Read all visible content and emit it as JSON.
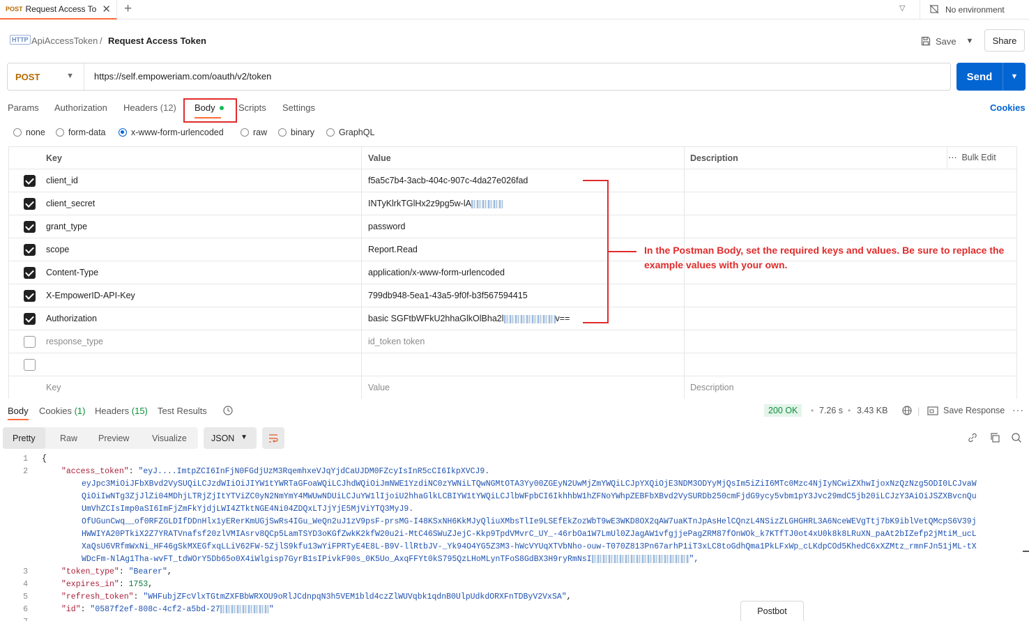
{
  "tab": {
    "method": "POST",
    "title": "Request Access To"
  },
  "environment": "No environment",
  "breadcrumb": {
    "collection": "ApiAccessToken",
    "separator": "/",
    "request": "Request Access Token",
    "icon": "http-icon"
  },
  "toolbar": {
    "save": "Save",
    "share": "Share"
  },
  "request": {
    "method": "POST",
    "url": "https://self.empoweriam.com/oauth/v2/token",
    "send": "Send"
  },
  "request_tabs": {
    "params": "Params",
    "authorization": "Authorization",
    "headers": "Headers",
    "headers_count": "(12)",
    "body": "Body",
    "scripts": "Scripts",
    "settings": "Settings",
    "cookies": "Cookies"
  },
  "body_types": [
    "none",
    "form-data",
    "x-www-form-urlencoded",
    "raw",
    "binary",
    "GraphQL"
  ],
  "body_type_selected": "x-www-form-urlencoded",
  "table": {
    "headers": {
      "key": "Key",
      "value": "Value",
      "description": "Description",
      "bulk_edit": "Bulk Edit"
    },
    "rows": [
      {
        "checked": true,
        "key": "client_id",
        "value": "f5a5c7b4-3acb-404c-907c-4da27e026fad"
      },
      {
        "checked": true,
        "key": "client_secret",
        "value": "INTyKlrkTGlHx2z9pg5w-lA"
      },
      {
        "checked": true,
        "key": "grant_type",
        "value": "password"
      },
      {
        "checked": true,
        "key": "scope",
        "value": "Report.Read"
      },
      {
        "checked": true,
        "key": "Content-Type",
        "value": "application/x-www-form-urlencoded"
      },
      {
        "checked": true,
        "key": "X-EmpowerID-API-Key",
        "value": "799db948-5ea1-43a5-9f0f-b3f567594415"
      },
      {
        "checked": true,
        "key": "Authorization",
        "value": "basic SGFtbWFkU2hhaGlkOlBha2l",
        "value_suffix": "v=="
      },
      {
        "checked": false,
        "key": "response_type",
        "value": "id_token token"
      }
    ],
    "placeholder": {
      "key": "Key",
      "value": "Value",
      "description": "Description"
    }
  },
  "annotation": "In the Postman Body, set the required keys and values. Be sure to replace the example values with your own.",
  "response": {
    "tabs": {
      "body": "Body",
      "cookies": "Cookies",
      "cookies_count": "(1)",
      "headers": "Headers",
      "headers_count": "(15)",
      "test_results": "Test Results"
    },
    "status": "200 OK",
    "time": "7.26 s",
    "size": "3.43 KB",
    "save_response": "Save Response",
    "views": [
      "Pretty",
      "Raw",
      "Preview",
      "Visualize"
    ],
    "format": "JSON"
  },
  "code": {
    "line_numbers": [
      "1",
      "2",
      "3",
      "4",
      "5",
      "6",
      "7"
    ],
    "open_brace": "{",
    "access_token_key": "\"access_token\"",
    "access_token_first": "\"eyJ....ImtpZCI6InFjN0FGdjUzM3RqemhxeVJqYjdCaUJDM0FZcyIsInR5cCI6IkpXVCJ9.",
    "access_token_lines": [
      "eyJpc3MiOiJFbXBvd2VySUQiLCJzdWIiOiJIYW1tYWRTaGFoaWQiLCJhdWQiOiJmNWE1YzdiNC0zYWNiLTQwNGMtOTA3Yy00ZGEyN2UwMjZmYWQiLCJpYXQiOjE3NDM3ODYyMjQsIm5iZiI6MTc0Mzc4NjIyNCwiZXhwIjoxNzQzNzg5ODI0LCJvaW",
      "QiOiIwNTg3ZjJlZi04MDhjLTRjZjItYTViZC0yN2NmYmY4MWUwNDUiLCJuYW1lIjoiU2hhaGlkLCBIYW1tYWQiLCJlbWFpbCI6IkhhbW1hZFNoYWhpZEBFbXBvd2VySURDb250cmFjdG9ycy5vbm1pY3Jvc29mdC5jb20iLCJzY3AiOiJSZXBvcnQu",
      "UmVhZCIsImp0aSI6ImFjZmFkYjdjLWI4ZTktNGE4Ni04ZDQxLTJjYjE5MjViYTQ3MyJ9.",
      "OfUGunCwq__of0RFZGLDIfDDnHlx1yERerKmUGjSwRs4IGu_WeQn2uJ1zV9psF-prsMG-I48KSxNH6KkMJyQliuXMbsTlIe9LSEfEkZozWbT9wE3WKD8OX2qAW7uaKTnJpAsHelCQnzL4NSizZLGHGHRL3A6NceWEVgTtj7bK9iblVetQMcpS6V39j",
      "HWWIYA20PTkiX2Z7YRATVnafsf20zlVMIAsrv8QCp5LamTSYD3oKGfZwkK2kfW20u2i-MtC46SWuZJejC-Kkp9TpdVMvrC_UY_-46rbOa1W7LmUl0ZJagAW1vfgjjePagZRM87fOnWOk_k7KTfTJ0ot4xU0k8k8LRuXN_paAt2bIZefp2jMtiM_ucL",
      "XaQsU6VRfmWxNi_HF46gSkMXEGfxqLLiV62FW-5ZjlS9kfu13wYiFPRTyE4E8L-B9V-llRtbJV-_Yk94O4YG5Z3M3-hWcVYUqXTVbNho-ouw-T070Z813Pn67arhP1iT3xLC8toGdhQma1PkLFxWp_cLKdpCOd5KhedC6xXZMtz_rmnFJn51jML-tX",
      "WDcFm-NlAg1Tha-wvFT_tdWOrY5Db65o0X4iWlgisp7GyrB1sIPivkF90s_0K5Uo_AxqFFYt0kS795QzLHoMLynTFoS8GdBX3H9ryRmNsI"
    ],
    "access_token_end": "\",",
    "token_type_key": "\"token_type\"",
    "token_type_val": "\"Bearer\"",
    "expires_in_key": "\"expires_in\"",
    "expires_in_val": "1753",
    "refresh_token_key": "\"refresh_token\"",
    "refresh_token_val": "\"WHFubjZFcVlxTGtmZXFBbWRXOU9oRlJCdnpqN3h5VEM1bld4czZlWUVqbk1qdnB0UlpUdkdORXFnTDByV2VxSA\"",
    "id_key": "\"id\"",
    "id_val": "\"0587f2ef-808c-4cf2-a5bd-27",
    "id_end": "\""
  },
  "postbot": "Postbot"
}
